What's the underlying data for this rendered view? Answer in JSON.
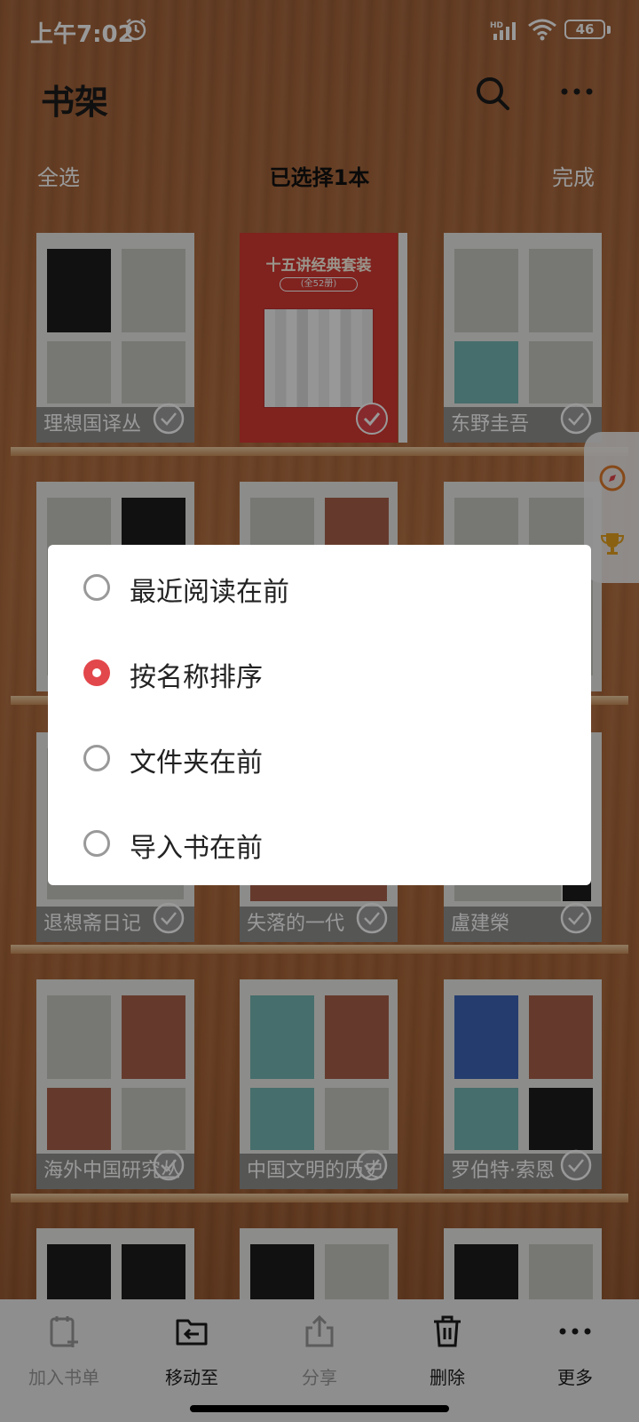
{
  "status_bar": {
    "time": "上午7:02",
    "battery": "46"
  },
  "header": {
    "title": "书架"
  },
  "selection_bar": {
    "select_all": "全选",
    "count": "已选择1本",
    "done": "完成"
  },
  "books": [
    {
      "title": "理想国译丛",
      "selected": false
    },
    {
      "title": "十五讲经典套装",
      "subtitle": "(全52册)",
      "selected": true
    },
    {
      "title": "东野圭吾",
      "selected": false
    },
    {
      "title": "退想斋日记",
      "selected": false
    },
    {
      "title": "失落的一代",
      "selected": false
    },
    {
      "title": "盧建榮",
      "selected": false
    },
    {
      "title": "海外中国研究丛",
      "selected": false
    },
    {
      "title": "中国文明的历史",
      "selected": false
    },
    {
      "title": "罗伯特·索恩",
      "selected": false
    }
  ],
  "sort_dialog": {
    "options": [
      {
        "label": "最近阅读在前",
        "selected": false
      },
      {
        "label": "按名称排序",
        "selected": true
      },
      {
        "label": "文件夹在前",
        "selected": false
      },
      {
        "label": "导入书在前",
        "selected": false
      }
    ]
  },
  "toolbar": {
    "items": [
      {
        "label": "加入书单",
        "enabled": false,
        "icon": "add-to-list-icon"
      },
      {
        "label": "移动至",
        "enabled": true,
        "icon": "move-to-folder-icon"
      },
      {
        "label": "分享",
        "enabled": false,
        "icon": "share-icon"
      },
      {
        "label": "删除",
        "enabled": true,
        "icon": "trash-icon"
      },
      {
        "label": "更多",
        "enabled": true,
        "icon": "more-icon"
      }
    ]
  },
  "colors": {
    "accent": "#E2474B",
    "wood": "#B46F3F",
    "dialog_bg": "#FFFFFF"
  }
}
